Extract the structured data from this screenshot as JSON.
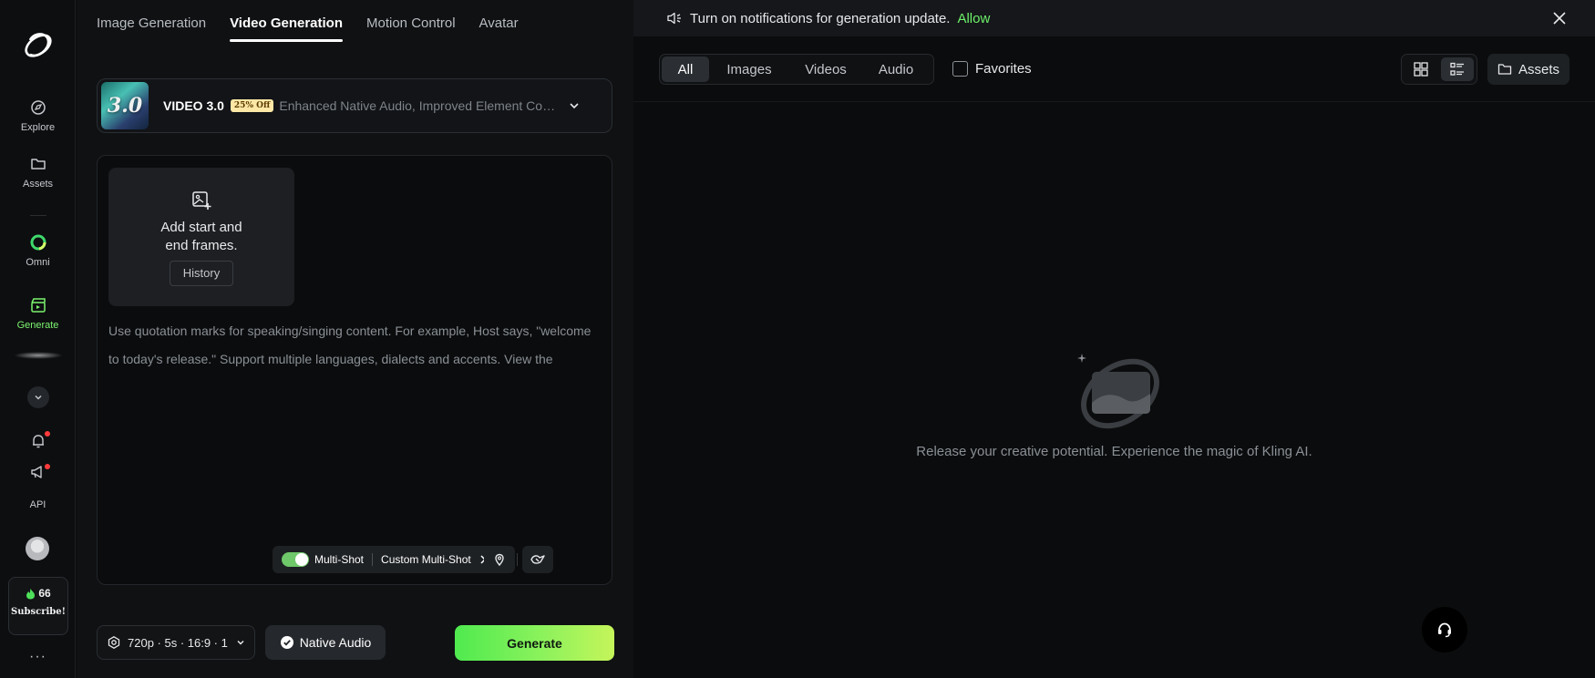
{
  "rail": {
    "items": [
      {
        "label": "Explore",
        "icon": "compass-icon"
      },
      {
        "label": "Assets",
        "icon": "folder-icon"
      },
      {
        "label": "Omni",
        "icon": "omni-ring-icon"
      },
      {
        "label": "Generate",
        "icon": "clapperboard-icon"
      }
    ],
    "api_label": "API",
    "credits": "66",
    "subscribe_label": "Subscribe!",
    "more_label": "···"
  },
  "tabs": [
    {
      "label": "Image Generation",
      "active": false
    },
    {
      "label": "Video Generation",
      "active": true
    },
    {
      "label": "Motion Control",
      "active": false
    },
    {
      "label": "Avatar",
      "active": false
    }
  ],
  "model": {
    "thumb_text": "3.0",
    "name": "VIDEO 3.0",
    "badge": "25% Off",
    "description": "Enhanced Native Audio, Improved Element Consistency"
  },
  "frames": {
    "line1": "Add start and",
    "line2": "end frames.",
    "history_label": "History"
  },
  "prompt": {
    "placeholder": "Use quotation marks for speaking/singing content. For example, Host says, \"welcome to today's release.\" Support multiple languages, dialects and accents. View the"
  },
  "multishot": {
    "enabled": true,
    "label": "Multi-Shot",
    "custom_label": "Custom Multi-Shot"
  },
  "settings": {
    "summary": "720p · 5s · 16:9 · 1"
  },
  "native_audio": {
    "label": "Native Audio"
  },
  "generate": {
    "label": "Generate"
  },
  "notice": {
    "text": "Turn on notifications for generation update.",
    "action": "Allow"
  },
  "filters": [
    {
      "label": "All",
      "active": true
    },
    {
      "label": "Images",
      "active": false
    },
    {
      "label": "Videos",
      "active": false
    },
    {
      "label": "Audio",
      "active": false
    }
  ],
  "favorites_label": "Favorites",
  "assets_label": "Assets",
  "empty_message": "Release your creative potential. Experience the magic of Kling AI.",
  "colors": {
    "accent": "#6ef06a",
    "generate_start": "#4fea4f",
    "generate_end": "#c5f55a",
    "badge_bg": "#ffe8a6"
  }
}
